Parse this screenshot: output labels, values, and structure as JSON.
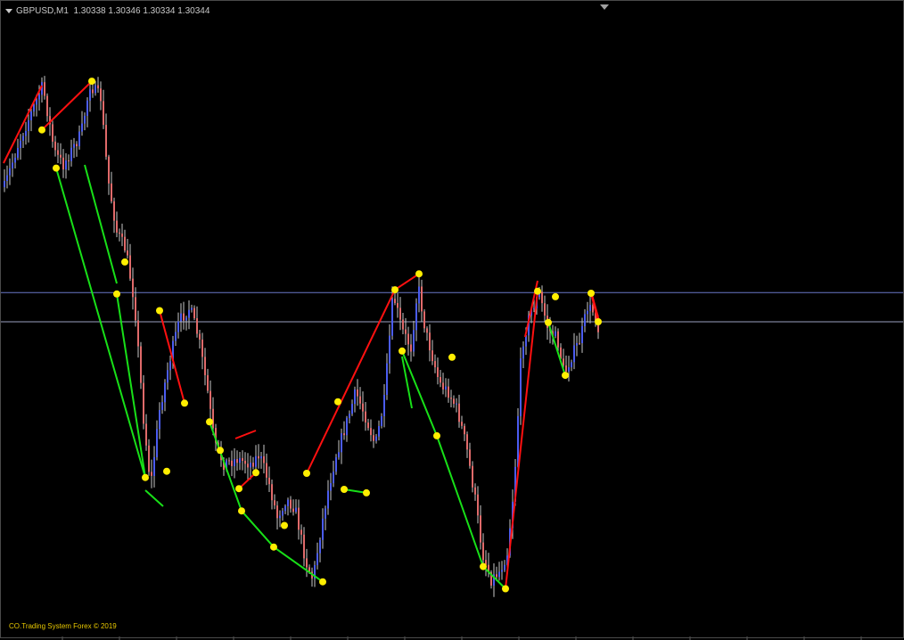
{
  "window": {
    "symbol": "GBPUSD,M1",
    "ohlc": "1.30338 1.30346 1.30334 1.30344",
    "copyright": "CO.Trading System Forex  ©  2019"
  },
  "colors": {
    "background": "#000000",
    "bull_candle": "#4b5cf0",
    "bear_candle": "#e06a6a",
    "wick": "#c8c8c8",
    "up_leg": "#ff1010",
    "down_leg": "#18e018",
    "pivot": "#ffee00",
    "hline": "#6a78c8"
  },
  "chart_data": {
    "type": "candlestick",
    "title": "GBPUSD,M1",
    "price_levels": [
      1.30386,
      1.30344
    ],
    "zigzag_pivots": [
      {
        "kind": "high",
        "price": 1.3062
      },
      {
        "kind": "high",
        "price": 1.3069
      },
      {
        "kind": "low",
        "price": 1.30565
      },
      {
        "kind": "high",
        "price": 1.3043
      },
      {
        "kind": "low",
        "price": 1.30384
      },
      {
        "kind": "low",
        "price": 1.3012
      },
      {
        "kind": "high",
        "price": 1.30227
      },
      {
        "kind": "high",
        "price": 1.3036
      },
      {
        "kind": "high",
        "price": 1.30129
      },
      {
        "kind": "low",
        "price": 1.302
      },
      {
        "kind": "low",
        "price": 1.30072
      },
      {
        "kind": "high",
        "price": 1.30159
      },
      {
        "kind": "low",
        "price": 1.30127
      },
      {
        "kind": "high",
        "price": 1.30104
      },
      {
        "kind": "low",
        "price": 1.3002
      },
      {
        "kind": "low",
        "price": 1.2997
      },
      {
        "kind": "high",
        "price": 1.30051
      },
      {
        "kind": "high",
        "price": 1.30229
      },
      {
        "kind": "low",
        "price": 1.30126
      },
      {
        "kind": "low",
        "price": 1.30103
      },
      {
        "kind": "high",
        "price": 1.3039
      },
      {
        "kind": "high",
        "price": 1.30413
      },
      {
        "kind": "low",
        "price": 1.30302
      },
      {
        "kind": "low",
        "price": 1.3018
      },
      {
        "kind": "high",
        "price": 1.30293
      },
      {
        "kind": "high",
        "price": 1.30098
      },
      {
        "kind": "low",
        "price": 1.29992
      },
      {
        "kind": "low",
        "price": 1.2996
      },
      {
        "kind": "high",
        "price": 1.30388
      },
      {
        "kind": "low",
        "price": 1.30343
      },
      {
        "kind": "high",
        "price": 1.3038
      },
      {
        "kind": "low",
        "price": 1.30267
      },
      {
        "kind": "high",
        "price": 1.30385
      },
      {
        "kind": "low",
        "price": 1.30344
      }
    ]
  }
}
